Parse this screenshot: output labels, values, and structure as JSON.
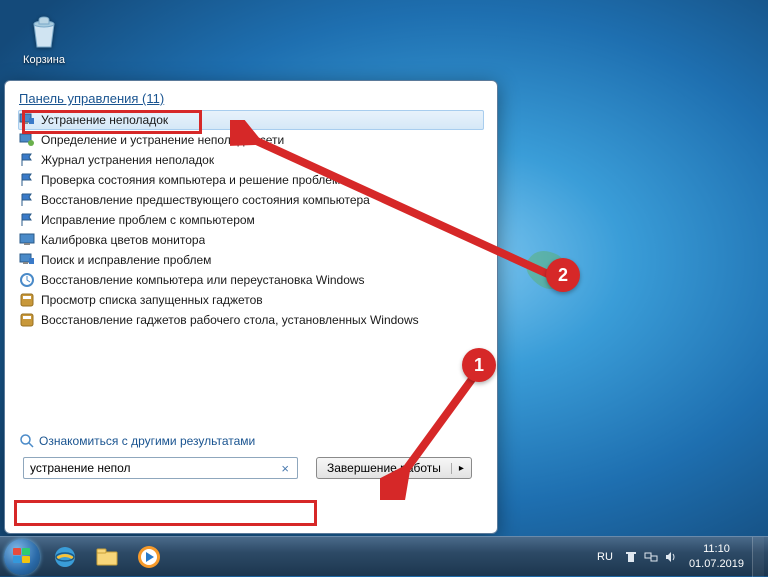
{
  "desktop": {
    "recycle_bin_label": "Корзина"
  },
  "start_menu": {
    "header": "Панель управления (11)",
    "results": [
      {
        "icon": "monitor-flag",
        "label": "Устранение неполадок",
        "selected": true
      },
      {
        "icon": "monitor-net",
        "label": "Определение и устранение неполадок сети"
      },
      {
        "icon": "flag",
        "label": "Журнал устранения неполадок"
      },
      {
        "icon": "flag",
        "label": "Проверка состояния компьютера и решение проблем"
      },
      {
        "icon": "flag",
        "label": "Восстановление предшествующего состояния компьютера"
      },
      {
        "icon": "flag",
        "label": "Исправление проблем с компьютером"
      },
      {
        "icon": "monitor",
        "label": "Калибровка цветов монитора"
      },
      {
        "icon": "monitor-flag",
        "label": "Поиск и исправление проблем"
      },
      {
        "icon": "recovery",
        "label": "Восстановление компьютера или переустановка Windows"
      },
      {
        "icon": "gadget",
        "label": "Просмотр списка запущенных гаджетов"
      },
      {
        "icon": "gadget",
        "label": "Восстановление гаджетов рабочего стола, установленных Windows"
      }
    ],
    "more_results": "Ознакомиться с другими результатами",
    "search_value": "устранение непол",
    "search_clear": "×",
    "shutdown_label": "Завершение работы",
    "shutdown_arrow": "▸"
  },
  "annotations": {
    "step1": "1",
    "step2": "2"
  },
  "taskbar": {
    "language": "RU",
    "time": "11:10",
    "date": "01.07.2019"
  }
}
